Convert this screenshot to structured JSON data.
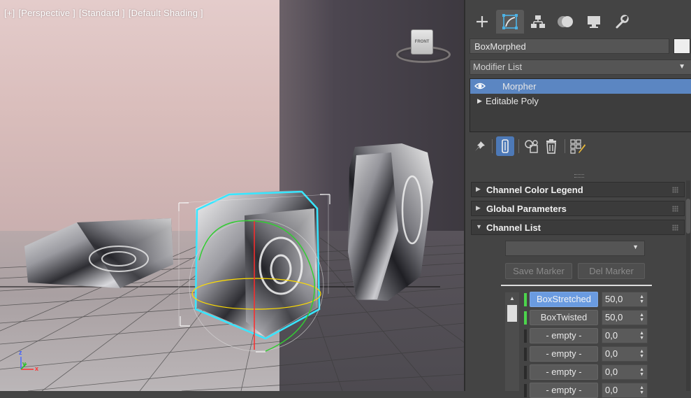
{
  "viewport": {
    "label": {
      "plus": "[+]",
      "view": "[Perspective ]",
      "mode": "[Standard ]",
      "shading": "[Default Shading ]"
    },
    "viewcube_face": "FRONT",
    "axis": {
      "x": "x",
      "y": "y",
      "z": "z"
    },
    "colors": {
      "selection": "#38e6ff",
      "gizmo_red": "#ff2a2a",
      "gizmo_green": "#33cc33",
      "gizmo_yellow": "#ffdd00"
    }
  },
  "command_panel": {
    "tabs": [
      {
        "name": "create",
        "icon": "plus-icon"
      },
      {
        "name": "modify",
        "icon": "modify-icon",
        "active": true
      },
      {
        "name": "hierarchy",
        "icon": "hierarchy-icon"
      },
      {
        "name": "motion",
        "icon": "motion-icon"
      },
      {
        "name": "display",
        "icon": "display-icon"
      },
      {
        "name": "utilities",
        "icon": "wrench-icon"
      }
    ],
    "object_name": "BoxMorphed",
    "object_color": "#eeeeee",
    "modifier_list": "Modifier List",
    "stack": {
      "morpher": "Morpher",
      "editable_poly": "Editable Poly"
    },
    "rollouts": {
      "channel_color_legend": "Channel Color Legend",
      "global_parameters": "Global Parameters",
      "channel_list": "Channel List"
    },
    "save_marker": "Save Marker",
    "del_marker": "Del Marker",
    "channels": [
      {
        "name": "BoxStretched",
        "value": "50,0",
        "active": true,
        "selected": true
      },
      {
        "name": "BoxTwisted",
        "value": "50,0",
        "active": true,
        "selected": false
      },
      {
        "name": "- empty -",
        "value": "0,0",
        "active": false,
        "selected": false
      },
      {
        "name": "- empty -",
        "value": "0,0",
        "active": false,
        "selected": false
      },
      {
        "name": "- empty -",
        "value": "0,0",
        "active": false,
        "selected": false
      },
      {
        "name": "- empty -",
        "value": "0,0",
        "active": false,
        "selected": false
      }
    ]
  }
}
